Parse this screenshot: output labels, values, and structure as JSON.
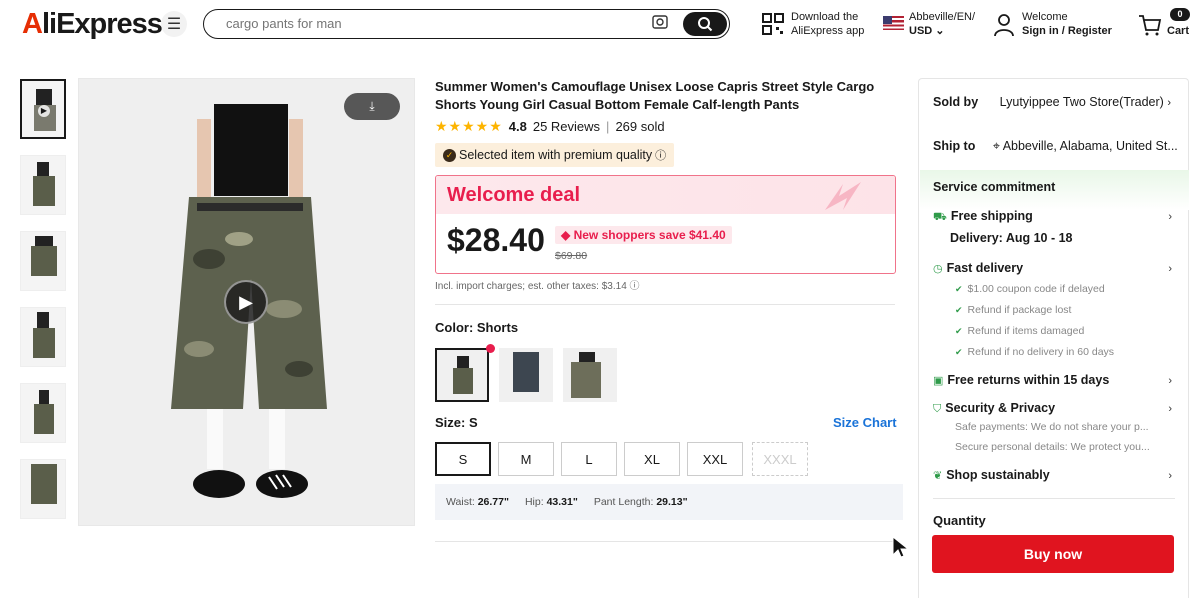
{
  "header": {
    "logo": "AliExpress",
    "search": {
      "placeholder": "cargo pants for man"
    },
    "download": {
      "line1": "Download the",
      "line2": "AliExpress app"
    },
    "locale": {
      "line1": "Abbeville/EN/",
      "line2": "USD"
    },
    "account": {
      "line1": "Welcome",
      "line2": "Sign in / Register"
    },
    "cart": {
      "count": "0",
      "label": "Cart"
    }
  },
  "product": {
    "title": "Summer Women's Camouflage Unisex Loose Capris Street Style Cargo Shorts Young Girl Casual Bottom Female Calf-length Pants",
    "rating": "4.8",
    "reviews": "25 Reviews",
    "sold": "269 sold",
    "premium": "Selected item with premium quality",
    "deal_title": "Welcome deal",
    "price": "$28.40",
    "save_text": "New shoppers save $41.40",
    "original_price": "$69.80",
    "tax_note": "Incl. import charges; est. other taxes: $3.14",
    "color_label": "Color: Shorts",
    "size_label": "Size: S",
    "size_chart": "Size Chart",
    "sizes": [
      "S",
      "M",
      "L",
      "XL",
      "XXL",
      "XXXL"
    ],
    "selected_size": "S",
    "measurements": {
      "waist_label": "Waist:",
      "waist_value": "26.77\"",
      "hip_label": "Hip:",
      "hip_value": "43.31\"",
      "pant_label": "Pant Length:",
      "pant_value": "29.13\""
    }
  },
  "panel": {
    "sold_by_label": "Sold by",
    "sold_by_value": "Lyutyippee Two Store(Trader)",
    "ship_to_label": "Ship to",
    "ship_to_value": "Abbeville, Alabama, United St...",
    "service_title": "Service commitment",
    "free_shipping": "Free shipping",
    "delivery": "Delivery: Aug 10 - 18",
    "fast_delivery": "Fast delivery",
    "fast_items": [
      "$1.00 coupon code if delayed",
      "Refund if package lost",
      "Refund if items damaged",
      "Refund if no delivery in 60 days"
    ],
    "free_returns": "Free returns within 15 days",
    "security": "Security & Privacy",
    "security_items": [
      "Safe payments: We do not share your p...",
      "Secure personal details: We protect you..."
    ],
    "sustainably": "Shop sustainably",
    "quantity": "Quantity",
    "buy_now": "Buy now"
  },
  "colors": {
    "brand_red": "#e62e04",
    "deal_red": "#e81e4d",
    "buy_red": "#e0141f",
    "link_blue": "#1a73d8",
    "green": "#2f9b4a",
    "star": "#fdb400"
  }
}
